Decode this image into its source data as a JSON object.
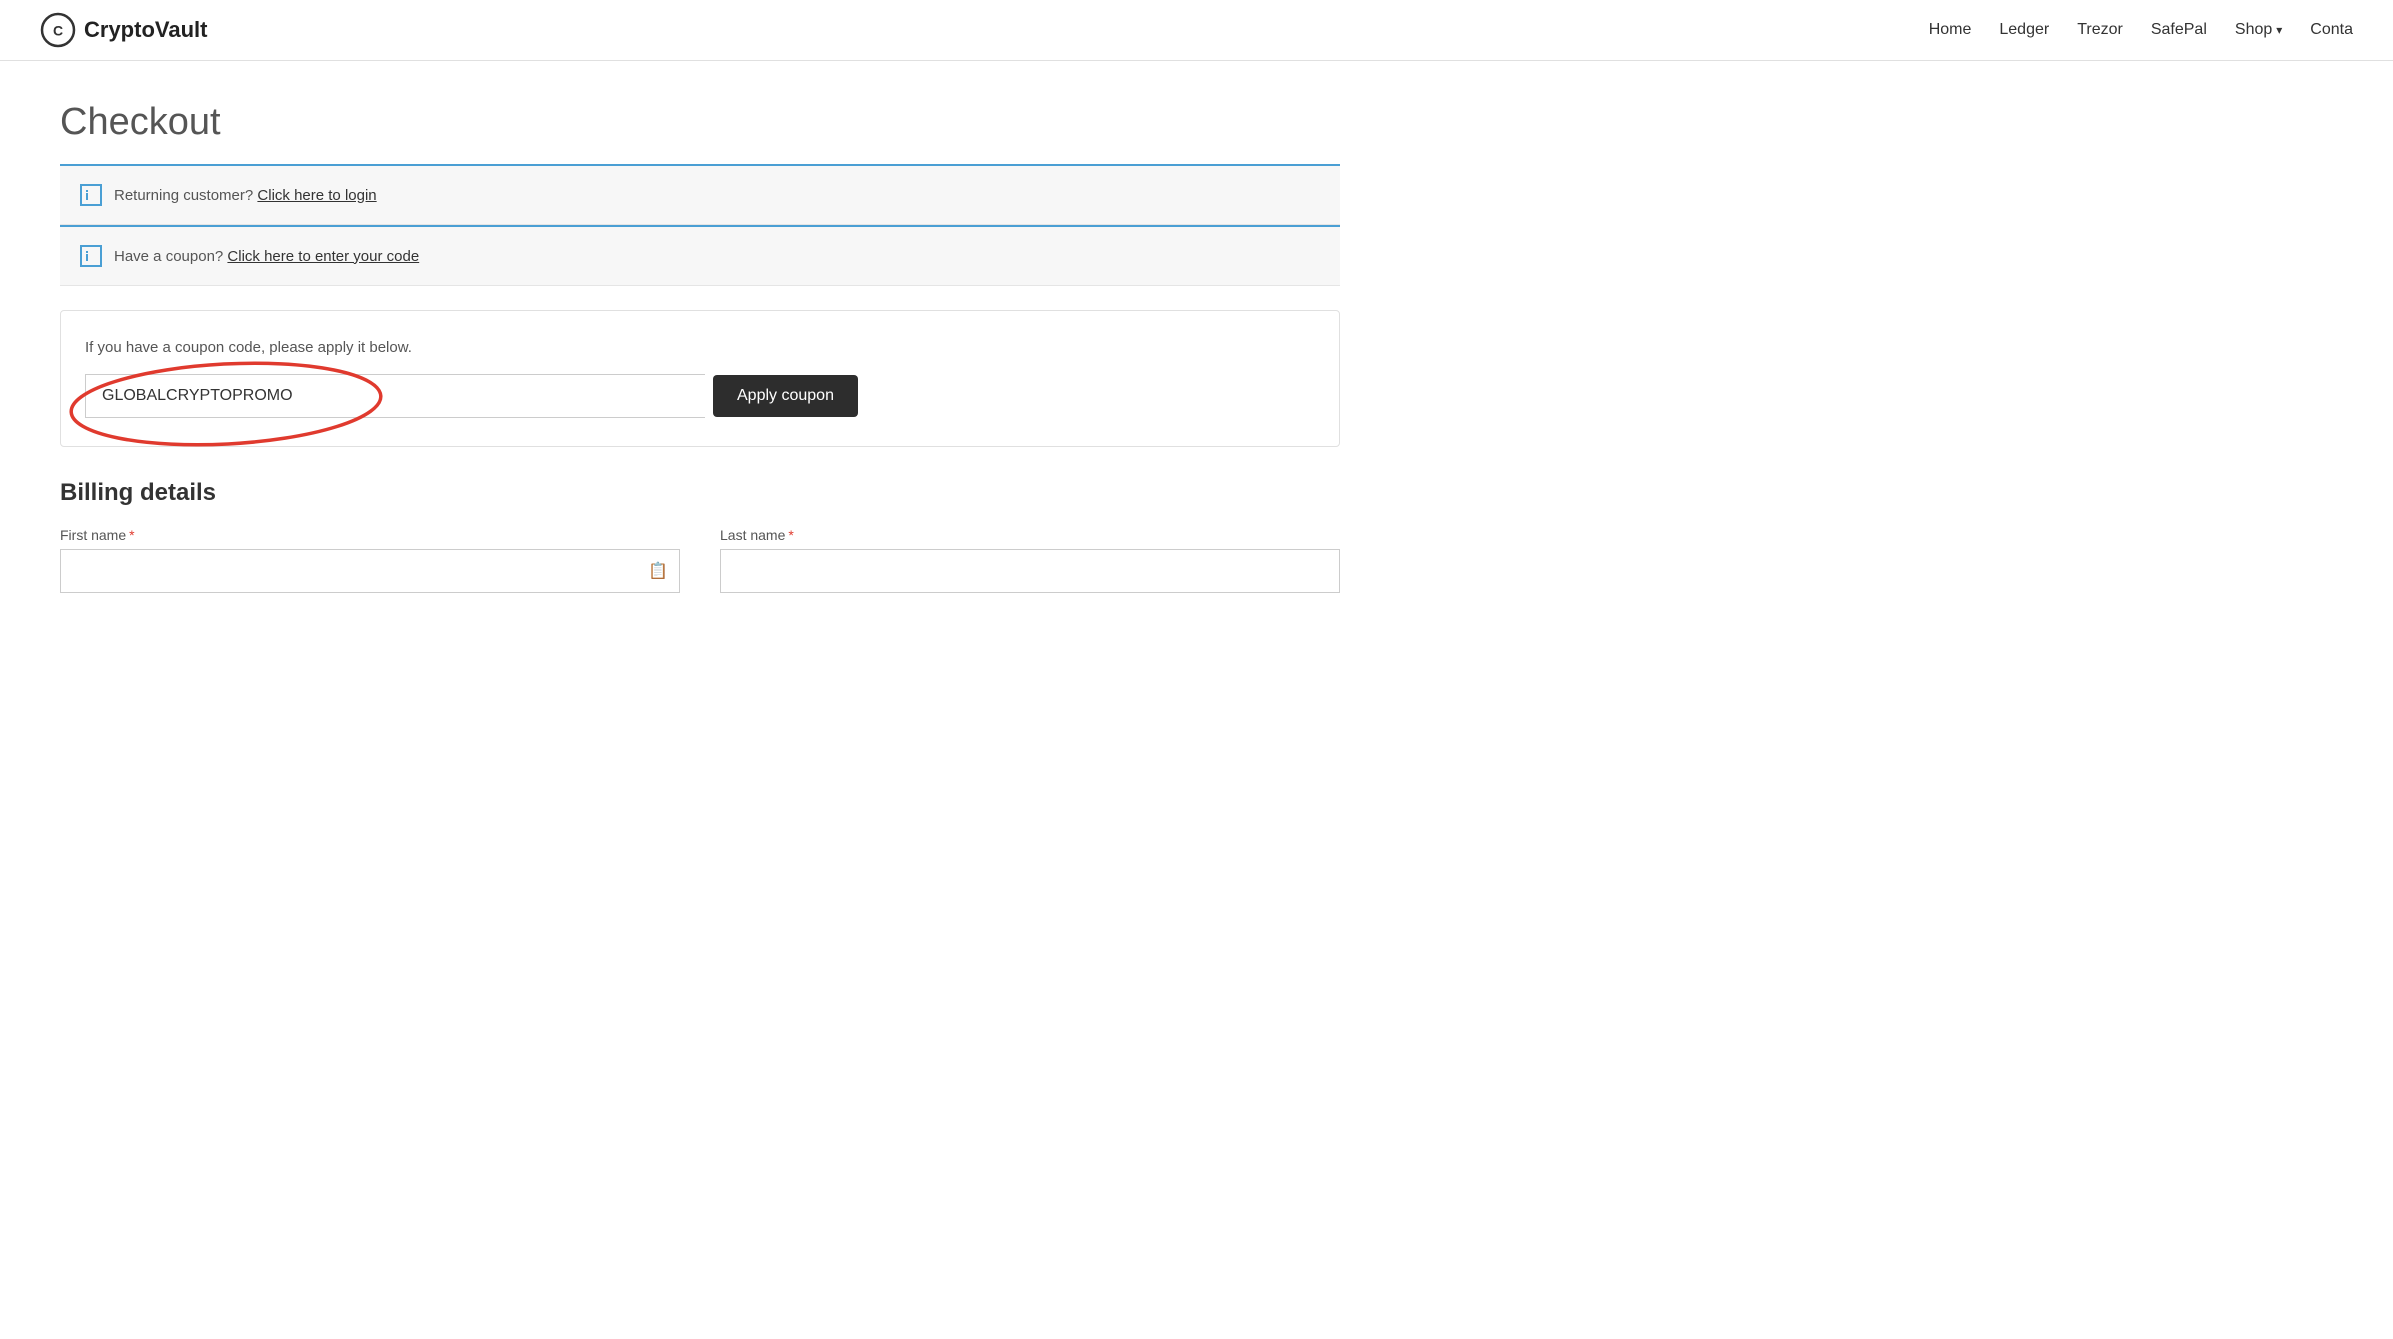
{
  "header": {
    "logo_text": "CryptoVault",
    "nav_items": [
      {
        "label": "Home",
        "href": "#"
      },
      {
        "label": "Ledger",
        "href": "#"
      },
      {
        "label": "Trezor",
        "href": "#"
      },
      {
        "label": "SafePal",
        "href": "#"
      },
      {
        "label": "Shop",
        "href": "#",
        "has_dropdown": true
      },
      {
        "label": "Conta",
        "href": "#"
      }
    ]
  },
  "page": {
    "title": "Checkout"
  },
  "returning_customer_bar": {
    "text": "Returning customer?",
    "link_text": "Click here to login"
  },
  "coupon_bar": {
    "text": "Have a coupon?",
    "link_text": "Click here to enter your code"
  },
  "coupon_section": {
    "instructions": "If you have a coupon code, please apply it below.",
    "input_value": "GLOBALCRYPTOPROMO",
    "input_placeholder": "",
    "apply_button_label": "Apply coupon"
  },
  "billing": {
    "title": "Billing details",
    "first_name_label": "First name",
    "last_name_label": "Last name",
    "required_marker": "*"
  }
}
